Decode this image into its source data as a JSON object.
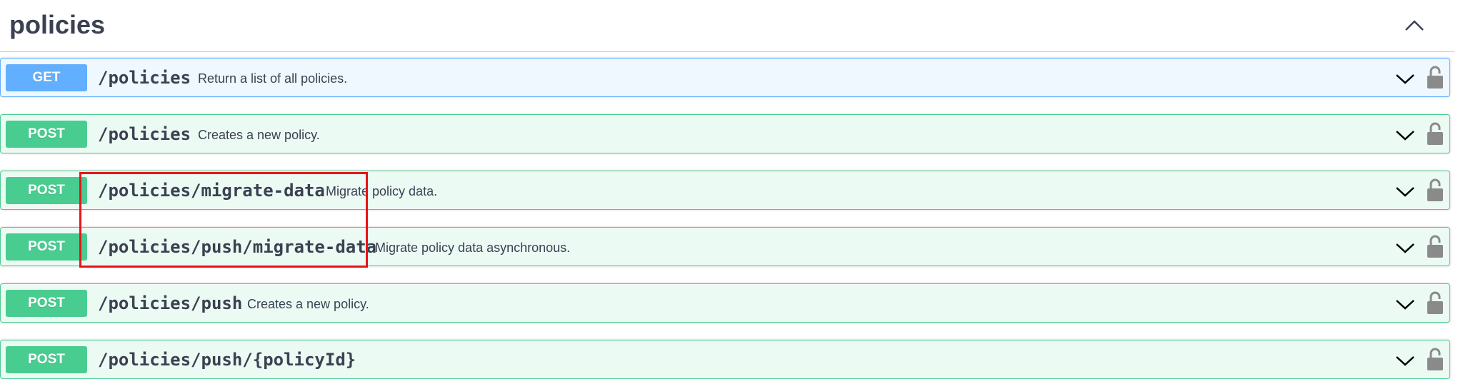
{
  "section": {
    "title": "policies"
  },
  "operations": [
    {
      "method": "GET",
      "path": "/policies",
      "summary": "Return a list of all policies."
    },
    {
      "method": "POST",
      "path": "/policies",
      "summary": "Creates a new policy."
    },
    {
      "method": "POST",
      "path": "/policies/migrate-data",
      "summary": "Migrate policy data."
    },
    {
      "method": "POST",
      "path": "/policies/push/migrate-data",
      "summary": "Migrate policy data asynchronous."
    },
    {
      "method": "POST",
      "path": "/policies/push",
      "summary": "Creates a new policy."
    },
    {
      "method": "POST",
      "path": "/policies/push/{policyId}",
      "summary": ""
    }
  ],
  "icons": {
    "collapse": "chevron-up-icon",
    "expand": "chevron-down-icon",
    "auth": "lock-icon"
  },
  "colors": {
    "get": "#61affe",
    "post": "#49cc90",
    "text": "#3b4151",
    "highlight": "#e8131a"
  }
}
